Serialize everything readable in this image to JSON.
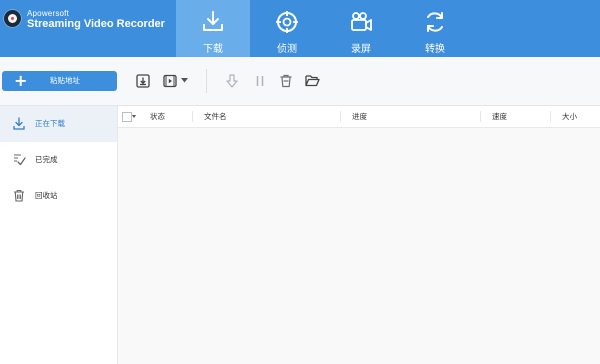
{
  "app": {
    "brand_small": "Apowersoft",
    "brand_main": "Streaming Video Recorder"
  },
  "tabs": [
    {
      "label": "下载",
      "icon": "download-tray-icon",
      "active": true
    },
    {
      "label": "侦测",
      "icon": "crosshair-icon",
      "active": false
    },
    {
      "label": "录屏",
      "icon": "video-camera-icon",
      "active": false
    },
    {
      "label": "转换",
      "icon": "convert-cycle-icon",
      "active": false
    }
  ],
  "toolbar": {
    "paste_label": "粘贴地址",
    "icons": [
      "download-box-icon",
      "video-play-box-icon",
      "dropdown-arrow-icon",
      "arrow-down-icon",
      "pause-icon",
      "trash-icon",
      "folder-open-icon"
    ]
  },
  "sidebar": {
    "items": [
      {
        "label": "正在下载",
        "icon": "download-icon",
        "active": true
      },
      {
        "label": "已完成",
        "icon": "check-list-icon",
        "active": false
      },
      {
        "label": "回收站",
        "icon": "trash-icon",
        "active": false
      }
    ]
  },
  "table": {
    "columns": [
      "状态",
      "文件名",
      "进度",
      "速度",
      "大小"
    ]
  },
  "colors": {
    "header": "#3d8fdd",
    "active_tab": "#69aeeb",
    "accent": "#3d8fdd"
  }
}
